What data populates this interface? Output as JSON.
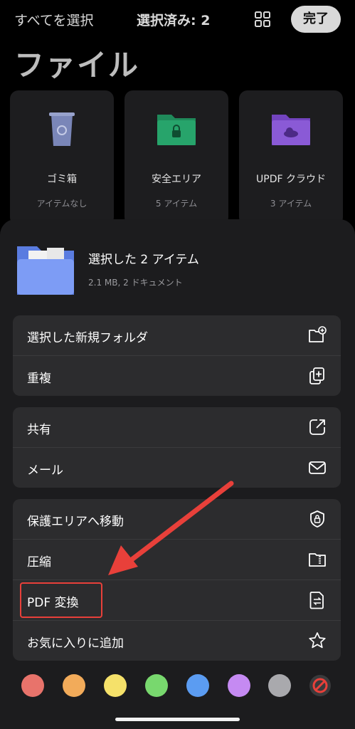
{
  "topbar": {
    "select_all": "すべてを選択",
    "selected_count": "選択済み: 2",
    "done": "完了"
  },
  "page_title": "ファイル",
  "cards": [
    {
      "name": "ゴミ箱",
      "count": "アイテムなし",
      "icon": "trash-icon",
      "color": "#7a86b8"
    },
    {
      "name": "安全エリア",
      "count": "5 アイテム",
      "icon": "lock-folder-icon",
      "color": "#1f8a5a"
    },
    {
      "name": "UPDF クラウド",
      "count": "3 アイテム",
      "icon": "cloud-folder-icon",
      "color": "#8a5ad6"
    }
  ],
  "selection": {
    "title": "選択した 2 アイテム",
    "subtitle": "2.1 MB, 2 ドキュメント"
  },
  "groups": [
    {
      "items": [
        {
          "label": "選択した新規フォルダ",
          "icon": "folder-plus-icon"
        },
        {
          "label": "重複",
          "icon": "duplicate-icon"
        }
      ]
    },
    {
      "items": [
        {
          "label": "共有",
          "icon": "share-icon"
        },
        {
          "label": "メール",
          "icon": "mail-icon"
        }
      ]
    },
    {
      "items": [
        {
          "label": "保護エリアへ移動",
          "icon": "shield-icon"
        },
        {
          "label": "圧縮",
          "icon": "compress-icon"
        },
        {
          "label": "PDF 変換",
          "icon": "convert-icon"
        },
        {
          "label": "お気に入りに追加",
          "icon": "star-icon"
        }
      ]
    }
  ],
  "colors": [
    "#e8736b",
    "#f2ab5a",
    "#f5e16a",
    "#78d86e",
    "#5b9cf2",
    "#c58af2",
    "#a9a9ad"
  ],
  "accent": "#e8403a"
}
